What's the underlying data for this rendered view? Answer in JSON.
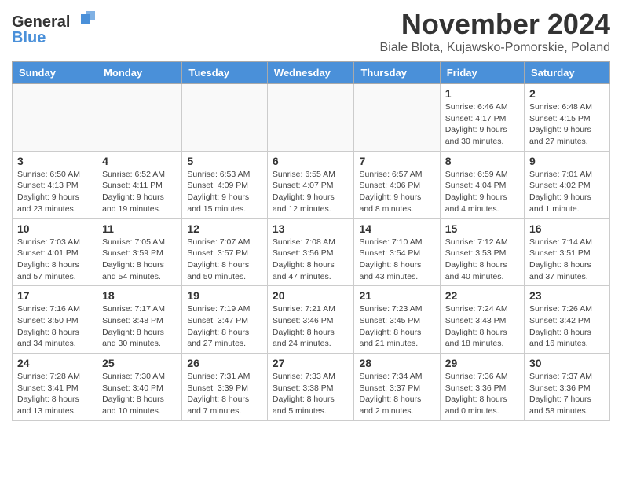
{
  "header": {
    "logo_general": "General",
    "logo_blue": "Blue",
    "month_title": "November 2024",
    "location": "Biale Blota, Kujawsko-Pomorskie, Poland"
  },
  "weekdays": [
    "Sunday",
    "Monday",
    "Tuesday",
    "Wednesday",
    "Thursday",
    "Friday",
    "Saturday"
  ],
  "weeks": [
    [
      {
        "day": "",
        "info": ""
      },
      {
        "day": "",
        "info": ""
      },
      {
        "day": "",
        "info": ""
      },
      {
        "day": "",
        "info": ""
      },
      {
        "day": "",
        "info": ""
      },
      {
        "day": "1",
        "info": "Sunrise: 6:46 AM\nSunset: 4:17 PM\nDaylight: 9 hours and 30 minutes."
      },
      {
        "day": "2",
        "info": "Sunrise: 6:48 AM\nSunset: 4:15 PM\nDaylight: 9 hours and 27 minutes."
      }
    ],
    [
      {
        "day": "3",
        "info": "Sunrise: 6:50 AM\nSunset: 4:13 PM\nDaylight: 9 hours and 23 minutes."
      },
      {
        "day": "4",
        "info": "Sunrise: 6:52 AM\nSunset: 4:11 PM\nDaylight: 9 hours and 19 minutes."
      },
      {
        "day": "5",
        "info": "Sunrise: 6:53 AM\nSunset: 4:09 PM\nDaylight: 9 hours and 15 minutes."
      },
      {
        "day": "6",
        "info": "Sunrise: 6:55 AM\nSunset: 4:07 PM\nDaylight: 9 hours and 12 minutes."
      },
      {
        "day": "7",
        "info": "Sunrise: 6:57 AM\nSunset: 4:06 PM\nDaylight: 9 hours and 8 minutes."
      },
      {
        "day": "8",
        "info": "Sunrise: 6:59 AM\nSunset: 4:04 PM\nDaylight: 9 hours and 4 minutes."
      },
      {
        "day": "9",
        "info": "Sunrise: 7:01 AM\nSunset: 4:02 PM\nDaylight: 9 hours and 1 minute."
      }
    ],
    [
      {
        "day": "10",
        "info": "Sunrise: 7:03 AM\nSunset: 4:01 PM\nDaylight: 8 hours and 57 minutes."
      },
      {
        "day": "11",
        "info": "Sunrise: 7:05 AM\nSunset: 3:59 PM\nDaylight: 8 hours and 54 minutes."
      },
      {
        "day": "12",
        "info": "Sunrise: 7:07 AM\nSunset: 3:57 PM\nDaylight: 8 hours and 50 minutes."
      },
      {
        "day": "13",
        "info": "Sunrise: 7:08 AM\nSunset: 3:56 PM\nDaylight: 8 hours and 47 minutes."
      },
      {
        "day": "14",
        "info": "Sunrise: 7:10 AM\nSunset: 3:54 PM\nDaylight: 8 hours and 43 minutes."
      },
      {
        "day": "15",
        "info": "Sunrise: 7:12 AM\nSunset: 3:53 PM\nDaylight: 8 hours and 40 minutes."
      },
      {
        "day": "16",
        "info": "Sunrise: 7:14 AM\nSunset: 3:51 PM\nDaylight: 8 hours and 37 minutes."
      }
    ],
    [
      {
        "day": "17",
        "info": "Sunrise: 7:16 AM\nSunset: 3:50 PM\nDaylight: 8 hours and 34 minutes."
      },
      {
        "day": "18",
        "info": "Sunrise: 7:17 AM\nSunset: 3:48 PM\nDaylight: 8 hours and 30 minutes."
      },
      {
        "day": "19",
        "info": "Sunrise: 7:19 AM\nSunset: 3:47 PM\nDaylight: 8 hours and 27 minutes."
      },
      {
        "day": "20",
        "info": "Sunrise: 7:21 AM\nSunset: 3:46 PM\nDaylight: 8 hours and 24 minutes."
      },
      {
        "day": "21",
        "info": "Sunrise: 7:23 AM\nSunset: 3:45 PM\nDaylight: 8 hours and 21 minutes."
      },
      {
        "day": "22",
        "info": "Sunrise: 7:24 AM\nSunset: 3:43 PM\nDaylight: 8 hours and 18 minutes."
      },
      {
        "day": "23",
        "info": "Sunrise: 7:26 AM\nSunset: 3:42 PM\nDaylight: 8 hours and 16 minutes."
      }
    ],
    [
      {
        "day": "24",
        "info": "Sunrise: 7:28 AM\nSunset: 3:41 PM\nDaylight: 8 hours and 13 minutes."
      },
      {
        "day": "25",
        "info": "Sunrise: 7:30 AM\nSunset: 3:40 PM\nDaylight: 8 hours and 10 minutes."
      },
      {
        "day": "26",
        "info": "Sunrise: 7:31 AM\nSunset: 3:39 PM\nDaylight: 8 hours and 7 minutes."
      },
      {
        "day": "27",
        "info": "Sunrise: 7:33 AM\nSunset: 3:38 PM\nDaylight: 8 hours and 5 minutes."
      },
      {
        "day": "28",
        "info": "Sunrise: 7:34 AM\nSunset: 3:37 PM\nDaylight: 8 hours and 2 minutes."
      },
      {
        "day": "29",
        "info": "Sunrise: 7:36 AM\nSunset: 3:36 PM\nDaylight: 8 hours and 0 minutes."
      },
      {
        "day": "30",
        "info": "Sunrise: 7:37 AM\nSunset: 3:36 PM\nDaylight: 7 hours and 58 minutes."
      }
    ]
  ]
}
